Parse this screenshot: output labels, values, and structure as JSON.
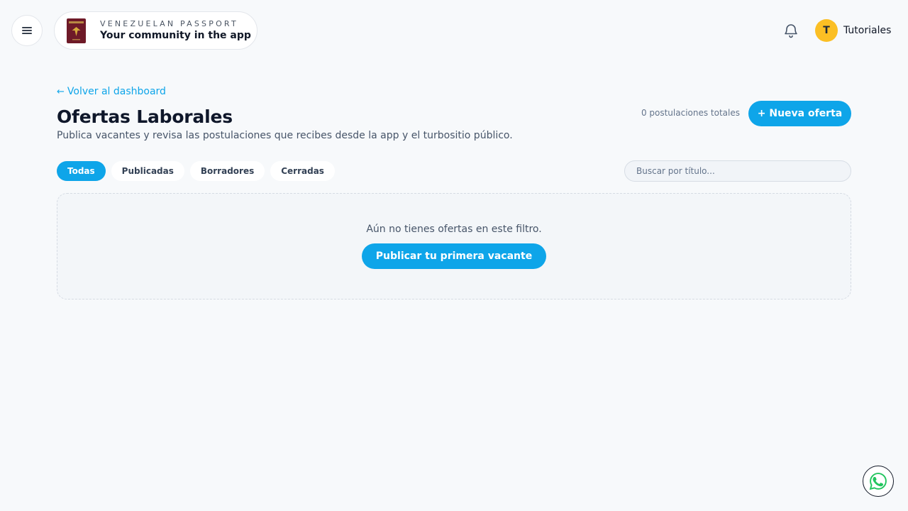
{
  "header": {
    "brand_title": "VENEZUELAN PASSPORT",
    "brand_subtitle": "Your community in the app",
    "user_initial": "T",
    "user_name": "Tutoriales",
    "icons": {
      "menu": "menu-icon",
      "passport": "passport-icon",
      "bell": "bell-icon"
    }
  },
  "main": {
    "back_link": "Volver al dashboard",
    "title": "Ofertas Laborales",
    "description": "Publica vacantes y revisa las postulaciones que recibes desde la app y el turbositio público.",
    "applications_count": "0 postulaciones totales",
    "new_offer_button": "+ Nueva oferta",
    "filters": [
      {
        "label": "Todas",
        "active": true
      },
      {
        "label": "Publicadas",
        "active": false
      },
      {
        "label": "Borradores",
        "active": false
      },
      {
        "label": "Cerradas",
        "active": false
      }
    ],
    "search_placeholder": "Buscar por título...",
    "empty_state": {
      "message": "Aún no tienes ofertas en este filtro.",
      "button": "Publicar tu primera vacante"
    }
  },
  "floating": {
    "whatsapp_icon": "whatsapp-icon"
  },
  "colors": {
    "accent": "#0ea5e9",
    "avatar": "#fbbf24",
    "passport": "#6e1a28",
    "background": "#f7f9fb"
  }
}
